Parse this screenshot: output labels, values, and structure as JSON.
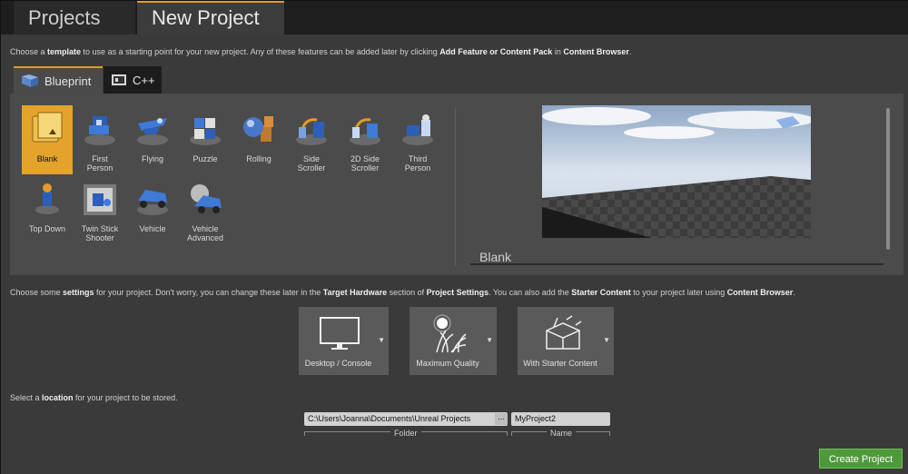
{
  "tabs": {
    "projects": "Projects",
    "new_project": "New Project"
  },
  "template_intro": {
    "t1": "Choose a ",
    "b1": "template",
    "t2": " to use as a starting point for your new project.  Any of these features can be added later by clicking ",
    "b2": "Add Feature or Content Pack",
    "t3": " in ",
    "b3": "Content Browser",
    "t4": "."
  },
  "template_tabs": {
    "blueprint": "Blueprint",
    "cpp": "C++"
  },
  "templates": [
    {
      "line1": "Blank",
      "line2": ""
    },
    {
      "line1": "First",
      "line2": "Person"
    },
    {
      "line1": "Flying",
      "line2": ""
    },
    {
      "line1": "Puzzle",
      "line2": ""
    },
    {
      "line1": "Rolling",
      "line2": ""
    },
    {
      "line1": "Side",
      "line2": "Scroller"
    },
    {
      "line1": "2D Side",
      "line2": "Scroller"
    },
    {
      "line1": "Third",
      "line2": "Person"
    },
    {
      "line1": "Top Down",
      "line2": ""
    },
    {
      "line1": "Twin Stick",
      "line2": "Shooter"
    },
    {
      "line1": "Vehicle",
      "line2": ""
    },
    {
      "line1": "Vehicle",
      "line2": "Advanced"
    }
  ],
  "preview": {
    "title": "Blank"
  },
  "settings_intro": {
    "t1": "Choose some ",
    "b1": "settings",
    "t2": " for your project.  Don't worry, you can change these later in the ",
    "b2": "Target Hardware",
    "t3": " section of ",
    "b3": "Project Settings",
    "t4": ".  You can also add the ",
    "b4": "Starter Content",
    "t5": " to your project later using ",
    "b5": "Content Browser",
    "t6": "."
  },
  "settings": {
    "hardware": "Desktop / Console",
    "quality": "Maximum Quality",
    "content": "With Starter Content"
  },
  "location_intro": {
    "t1": "Select a ",
    "b1": "location",
    "t2": " for your project to be stored."
  },
  "location": {
    "folder": "C:\\Users\\Joanna\\Documents\\Unreal Projects",
    "browse": "...",
    "name": "MyProject2",
    "folder_caption": "Folder",
    "name_caption": "Name"
  },
  "create_button": "Create Project",
  "colors": {
    "accent": "#e3a32c",
    "create": "#4e9a3a"
  }
}
